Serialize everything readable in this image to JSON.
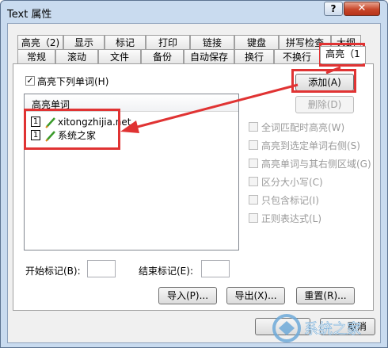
{
  "window": {
    "title": "Text 属性",
    "help_glyph": "?",
    "close_glyph": "✕"
  },
  "tabs_row1": [
    {
      "label": "高亮（2)"
    },
    {
      "label": "显示"
    },
    {
      "label": "标记"
    },
    {
      "label": "打印"
    },
    {
      "label": "链接"
    },
    {
      "label": "键盘"
    },
    {
      "label": "拼写检查"
    },
    {
      "label": "大纲"
    }
  ],
  "tabs_row2": [
    {
      "label": "常规"
    },
    {
      "label": "滚动"
    },
    {
      "label": "文件"
    },
    {
      "label": "备份"
    },
    {
      "label": "自动保存"
    },
    {
      "label": "换行"
    },
    {
      "label": "不换行"
    },
    {
      "label": "高亮（1"
    }
  ],
  "panel": {
    "highlight_checkbox_label": "高亮下列单词(H)",
    "highlight_checked": true,
    "list_header": "高亮单词",
    "words": [
      {
        "index": "1",
        "text": "xitongzhijia.net"
      },
      {
        "index": "1",
        "text": "系统之家"
      }
    ],
    "add_button": "添加(A)",
    "delete_button": "删除(D)",
    "options": [
      {
        "label": "全词匹配时高亮(W)"
      },
      {
        "label": "高亮到选定单词右侧(S)"
      },
      {
        "label": "高亮单词与其右侧区域(G)"
      },
      {
        "label": "区分大小写(C)"
      },
      {
        "label": "只包含标记(I)"
      },
      {
        "label": "正则表达式(L)"
      }
    ],
    "start_mark_label": "开始标记(B):",
    "end_mark_label": "结束标记(E):",
    "start_mark_value": "",
    "end_mark_value": "",
    "import_button": "导入(P)...",
    "export_button": "导出(X)...",
    "reset_button": "重置(R)..."
  },
  "footer": {
    "cancel_fragment": "取消"
  },
  "watermark": {
    "text": "系统之家"
  },
  "colors": {
    "annotation_red": "#e03333",
    "pencil_green": "#3a9a2a",
    "pencil_orange": "#e08a1a"
  }
}
